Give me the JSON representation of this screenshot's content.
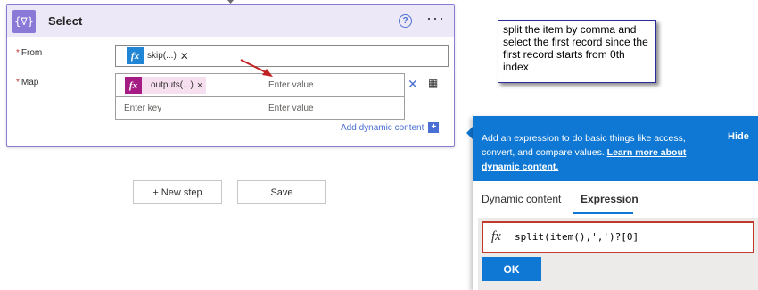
{
  "card": {
    "title": "Select",
    "icon": "select-braces-icon",
    "icon_glyph": "{∇}",
    "help_glyph": "?",
    "more_glyph": "···",
    "accent": "#8a79d6"
  },
  "from": {
    "label": "From",
    "required_mark": "*",
    "token": {
      "fx": "fx",
      "text": "skip(...)",
      "remove": "✕",
      "color": "#1f85d4"
    }
  },
  "map": {
    "label": "Map",
    "required_mark": "*",
    "key_token": {
      "fx": "fx",
      "text": "outputs(...)",
      "remove": "×",
      "color": "#a51c85"
    },
    "value_placeholder": "Enter value",
    "key_placeholder": "Enter key",
    "value_placeholder_2": "Enter value",
    "remove_glyph": "✕",
    "table_glyph": "▦"
  },
  "add_dynamic": {
    "label": "Add dynamic content",
    "plus": "+"
  },
  "buttons": {
    "new_step": "+ New step",
    "save": "Save"
  },
  "callout": {
    "text": "split the item by comma and select the first record since the first record starts from 0th index"
  },
  "panel": {
    "description": "Add an expression to do basic things like access, convert, and compare values.",
    "learn_more": "Learn more about dynamic content.",
    "hide": "Hide",
    "tabs": [
      "Dynamic content",
      "Expression"
    ],
    "active_tab": "Expression",
    "expression_fx": "fx",
    "expression": "split(item(),',')?[0]",
    "ok": "OK",
    "accent": "#0f78d4"
  }
}
